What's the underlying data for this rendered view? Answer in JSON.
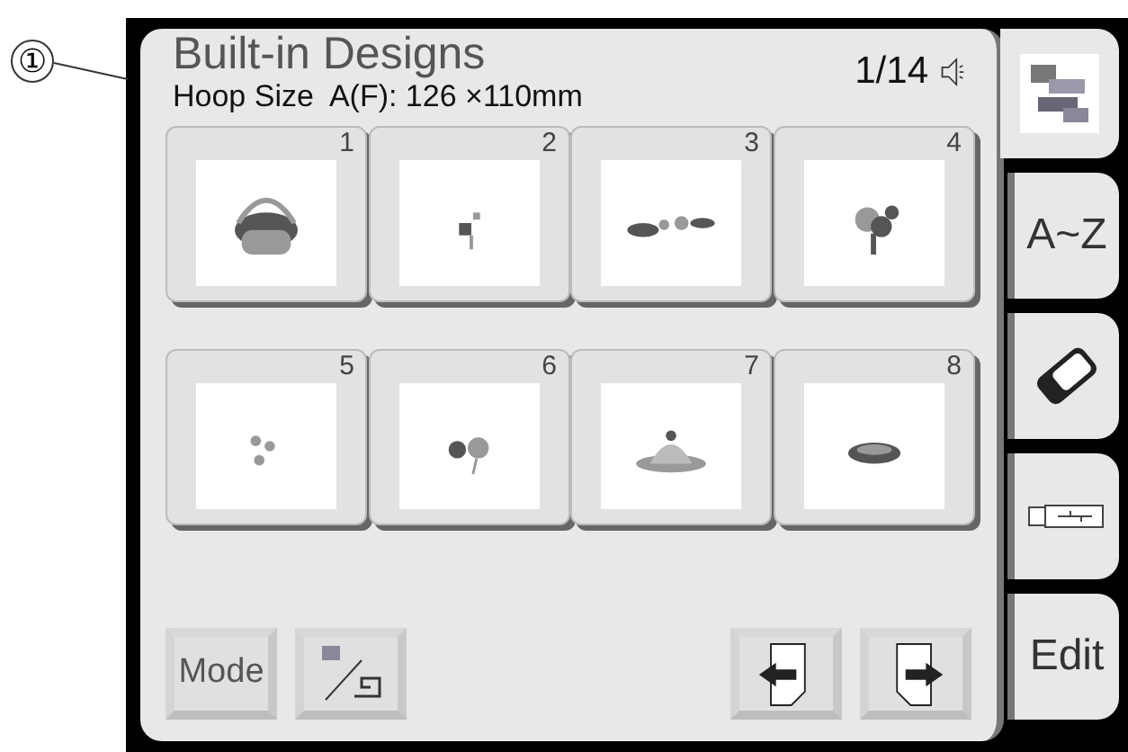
{
  "callout": "①",
  "header": {
    "title": "Built-in Designs",
    "hoop_size": "Hoop Size  A(F): 126 ×110mm",
    "page": "1/14"
  },
  "designs": [
    {
      "number": "1",
      "kind": "picture"
    },
    {
      "number": "2",
      "kind": "picture"
    },
    {
      "number": "3",
      "kind": "picture"
    },
    {
      "number": "4",
      "kind": "picture"
    },
    {
      "number": "5",
      "kind": "picture"
    },
    {
      "number": "6",
      "kind": "picture"
    },
    {
      "number": "7",
      "kind": "picture"
    },
    {
      "number": "8",
      "kind": "picture"
    }
  ],
  "buttons": {
    "mode": "Mode"
  },
  "tabs": [
    {
      "kind": "designs",
      "selected": true
    },
    {
      "kind": "text",
      "label": "A~Z",
      "selected": false
    },
    {
      "kind": "card",
      "selected": false
    },
    {
      "kind": "usb",
      "selected": false
    },
    {
      "kind": "text",
      "label": "Edit",
      "selected": false
    }
  ]
}
